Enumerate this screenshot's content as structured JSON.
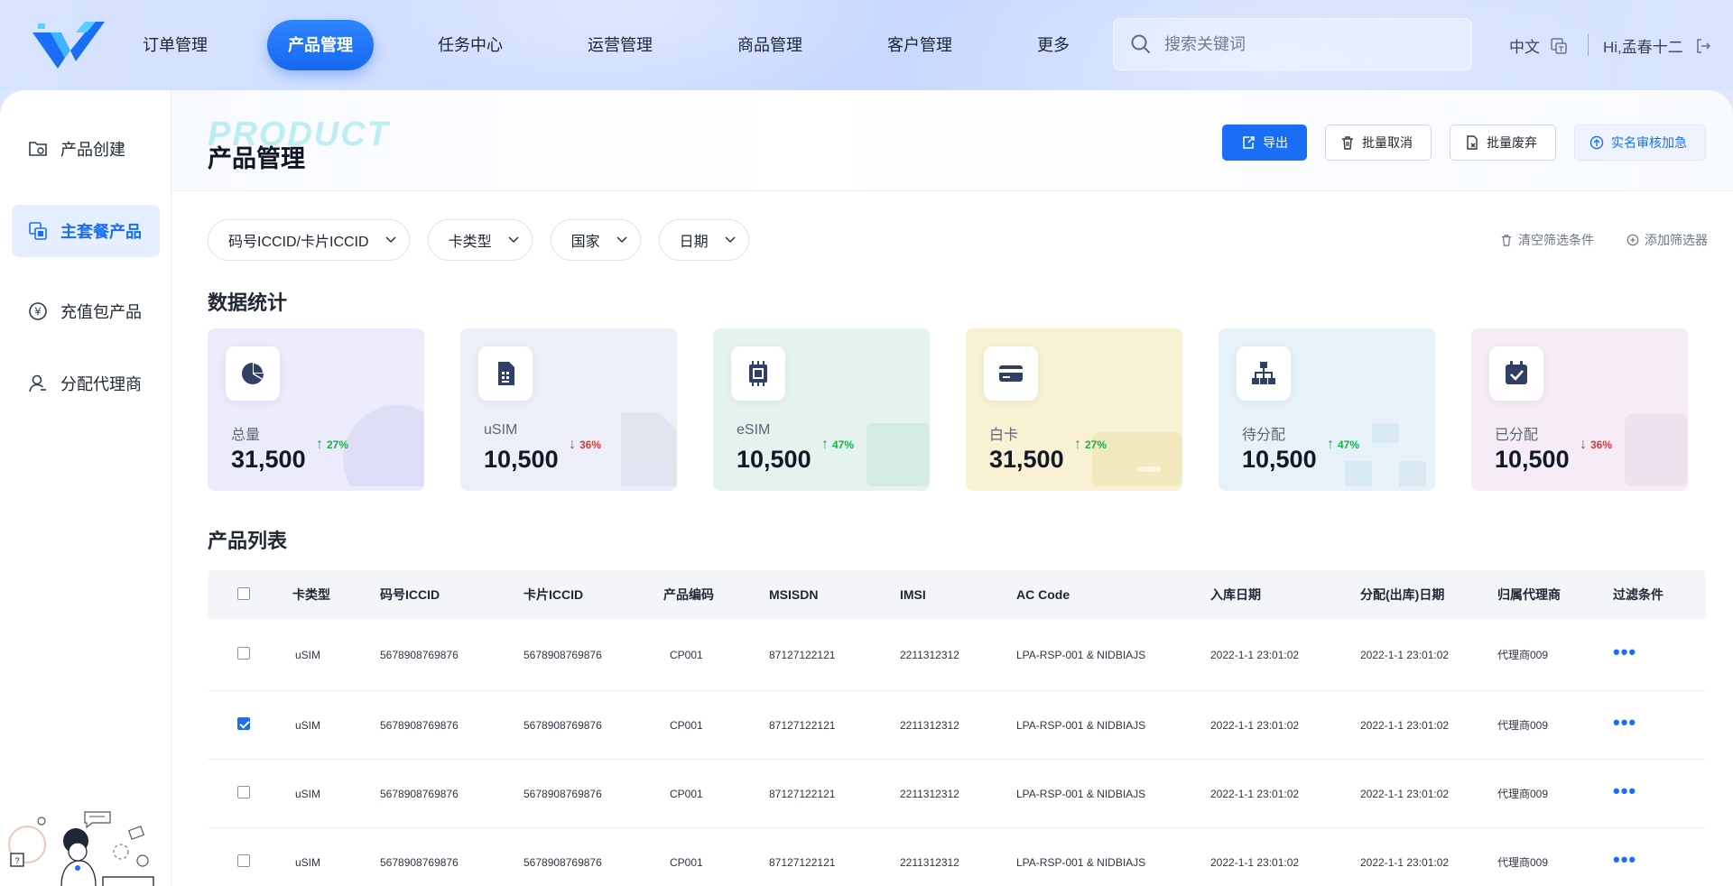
{
  "nav": {
    "items": [
      "订单管理",
      "产品管理",
      "任务中心",
      "运营管理",
      "商品管理",
      "客户管理",
      "更多"
    ],
    "active_index": 1
  },
  "search": {
    "placeholder": "搜索关键词"
  },
  "topbar": {
    "lang": "中文",
    "user": "Hi,孟春十二"
  },
  "sidebar": {
    "items": [
      {
        "label": "产品创建",
        "icon": "folder-settings-icon"
      },
      {
        "label": "主套餐产品",
        "icon": "copy-stack-icon"
      },
      {
        "label": "充值包产品",
        "icon": "yen-cycle-icon"
      },
      {
        "label": "分配代理商",
        "icon": "user-icon"
      }
    ],
    "active_index": 1
  },
  "page": {
    "title": "产品管理",
    "title_watermark": "PRODUCT"
  },
  "actions": {
    "export": "导出",
    "batch_cancel": "批量取消",
    "batch_discard": "批量废弃",
    "realname_expedite": "实名审核加急"
  },
  "filters": {
    "items": [
      "码号ICCID/卡片ICCID",
      "卡类型",
      "国家",
      "日期"
    ],
    "clear": "清空筛选条件",
    "add": "添加筛选器"
  },
  "stats": {
    "title": "数据统计",
    "cards": [
      {
        "label": "总量",
        "value": "31,500",
        "trend": "27%",
        "dir": "up",
        "bg": "#ecebfb",
        "icon": "pie-chart-icon"
      },
      {
        "label": "uSIM",
        "value": "10,500",
        "trend": "36%",
        "dir": "down",
        "bg": "#eceff7",
        "icon": "sim-card-icon"
      },
      {
        "label": "eSIM",
        "value": "10,500",
        "trend": "47%",
        "dir": "up",
        "bg": "#e4f3ee",
        "icon": "chip-icon"
      },
      {
        "label": "白卡",
        "value": "31,500",
        "trend": "27%",
        "dir": "up",
        "bg": "#f8f1d3",
        "icon": "card-icon"
      },
      {
        "label": "待分配",
        "value": "10,500",
        "trend": "47%",
        "dir": "up",
        "bg": "#e6f2f8",
        "icon": "hierarchy-icon"
      },
      {
        "label": "已分配",
        "value": "10,500",
        "trend": "36%",
        "dir": "down",
        "bg": "#f5ecf5",
        "icon": "calendar-check-icon"
      }
    ]
  },
  "table": {
    "title": "产品列表",
    "columns": [
      "卡类型",
      "码号ICCID",
      "卡片ICCID",
      "产品编码",
      "MSISDN",
      "IMSI",
      "AC Code",
      "入库日期",
      "分配(出库)日期",
      "归属代理商",
      "过滤条件"
    ],
    "rows": [
      {
        "checked": false,
        "cells": [
          "uSIM",
          "5678908769876",
          "5678908769876",
          "CP001",
          "87127122121",
          "2211312312",
          "LPA-RSP-001 & NIDBIAJS",
          "2022-1-1 23:01:02",
          "2022-1-1 23:01:02",
          "代理商009"
        ]
      },
      {
        "checked": true,
        "cells": [
          "uSIM",
          "5678908769876",
          "5678908769876",
          "CP001",
          "87127122121",
          "2211312312",
          "LPA-RSP-001 & NIDBIAJS",
          "2022-1-1 23:01:02",
          "2022-1-1 23:01:02",
          "代理商009"
        ]
      },
      {
        "checked": false,
        "cells": [
          "uSIM",
          "5678908769876",
          "5678908769876",
          "CP001",
          "87127122121",
          "2211312312",
          "LPA-RSP-001 & NIDBIAJS",
          "2022-1-1 23:01:02",
          "2022-1-1 23:01:02",
          "代理商009"
        ]
      },
      {
        "checked": false,
        "cells": [
          "uSIM",
          "5678908769876",
          "5678908769876",
          "CP001",
          "87127122121",
          "2211312312",
          "LPA-RSP-001 & NIDBIAJS",
          "2022-1-1 23:01:02",
          "2022-1-1 23:01:02",
          "代理商009"
        ]
      }
    ],
    "more_label": "•••"
  }
}
